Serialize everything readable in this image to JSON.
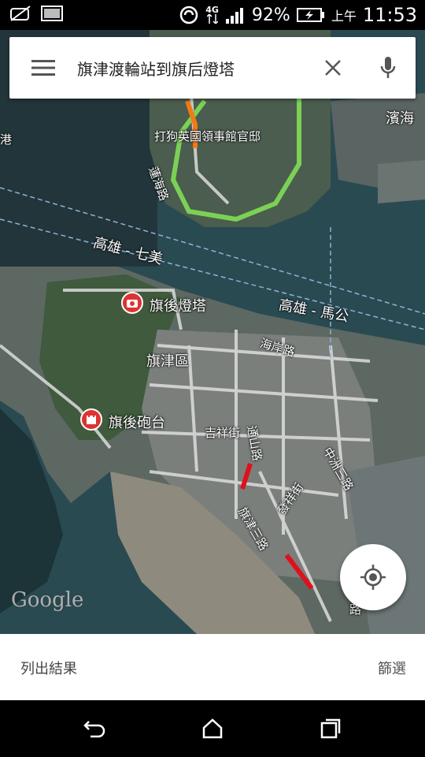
{
  "status_bar": {
    "network": "4G",
    "battery": "92%",
    "ampm": "上午",
    "time": "11:53",
    "icons": [
      "notification-icon",
      "image-icon",
      "nfc-icon",
      "data-arrows-icon",
      "signal-icon",
      "battery-charging-icon"
    ]
  },
  "search": {
    "query": "旗津渡輪站到旗后燈塔",
    "menu_icon": "menu-icon",
    "close_icon": "close-icon",
    "mic_icon": "mic-icon"
  },
  "map": {
    "labels": {
      "top_left": "港",
      "top_right": "濱海",
      "consulate": "打狗英國領事館官邸",
      "lianhai_road": "蓮海路",
      "ferry_route_1": "高雄 - 七美",
      "ferry_route_2": "高雄 - 馬公",
      "lighthouse": "旗後燈塔",
      "district": "旗津區",
      "haian_road": "海岸路",
      "fort": "旗後砲台",
      "jixiang_st": "吉祥街",
      "tongshan_road": "通山路",
      "zhongzhou_3rd": "中洲三路",
      "fuxiang_st": "發祥街",
      "qijin_3rd": "旗津三路",
      "road_edge": "路"
    },
    "watermark": "Google",
    "colors": {
      "route_green": "#7bd155",
      "route_orange": "#f07a1a",
      "traffic_red": "#e0101a",
      "marker_red": "#d33333",
      "water": "#25434a"
    }
  },
  "bottom": {
    "list_results": "列出結果",
    "filter": "篩選"
  },
  "nav": {
    "icons": [
      "back-icon",
      "home-icon",
      "recents-icon"
    ]
  }
}
